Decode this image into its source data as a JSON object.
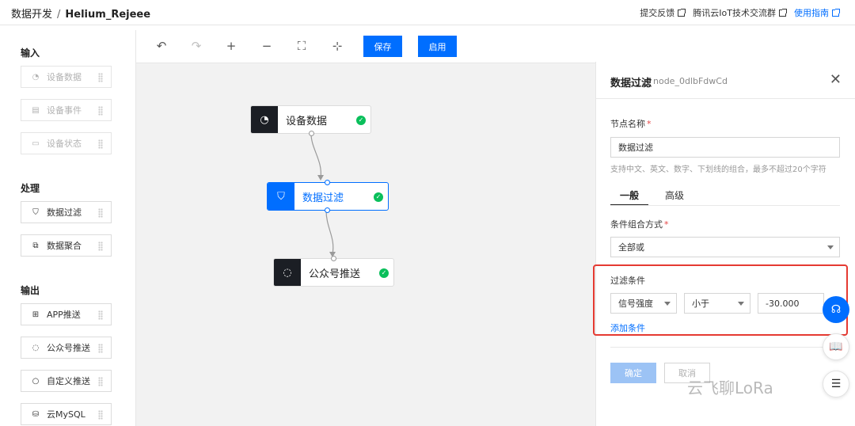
{
  "header": {
    "breadcrumb_root": "数据开发",
    "breadcrumb_sep": "/",
    "project_name": "Helium_Rejeee",
    "links": [
      {
        "label": "提交反馈"
      },
      {
        "label": "腾讯云IoT技术交流群"
      },
      {
        "label": "使用指南"
      }
    ]
  },
  "sidebar": {
    "input_title": "输入",
    "input_items": [
      {
        "label": "设备数据",
        "icon": "pie-chart-icon"
      },
      {
        "label": "设备事件",
        "icon": "document-icon"
      },
      {
        "label": "设备状态",
        "icon": "image-icon"
      }
    ],
    "process_title": "处理",
    "process_items": [
      {
        "label": "数据过滤",
        "icon": "filter-icon"
      },
      {
        "label": "数据聚合",
        "icon": "aggregate-icon"
      }
    ],
    "output_title": "输出",
    "output_items": [
      {
        "label": "APP推送",
        "icon": "apps-icon"
      },
      {
        "label": "公众号推送",
        "icon": "chat-icon"
      },
      {
        "label": "自定义推送",
        "icon": "bulb-icon"
      },
      {
        "label": "云MySQL",
        "icon": "database-icon"
      }
    ]
  },
  "toolbar": {
    "save_label": "保存",
    "enable_label": "启用"
  },
  "flow": {
    "nodes": [
      {
        "label": "设备数据",
        "icon": "pie-chart-icon",
        "status": "ok"
      },
      {
        "label": "数据过滤",
        "icon": "filter-icon",
        "status": "ok"
      },
      {
        "label": "公众号推送",
        "icon": "chat-icon",
        "status": "ok"
      }
    ]
  },
  "panel": {
    "title": "数据过滤",
    "node_id": "node_0dlbFdwCd",
    "name_label": "节点名称",
    "required_mark": "*",
    "name_value": "数据过滤",
    "name_hint": "支持中文、英文、数字、下划线的组合，最多不超过20个字符",
    "tab_general": "一般",
    "tab_advanced": "高级",
    "combine_label": "条件组合方式",
    "combine_value": "全部或",
    "filter_label": "过滤条件",
    "condition": {
      "field": "信号强度",
      "operator": "小于",
      "value": "-30.000"
    },
    "add_condition": "添加条件",
    "confirm_label": "确定",
    "cancel_label": "取消"
  },
  "watermark": "云飞聊LoRa",
  "colors": {
    "primary": "#006eff",
    "dark_node": "#1b1e24",
    "success": "#0abf5b",
    "highlight": "#e53a32"
  }
}
